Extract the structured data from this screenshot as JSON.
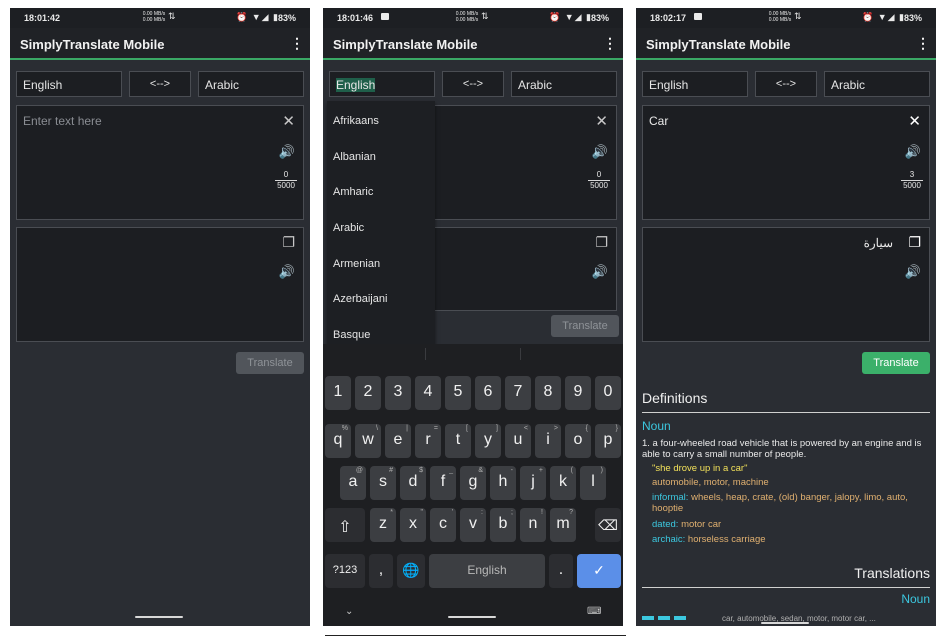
{
  "app": {
    "title": "SimplyTranslate Mobile",
    "menu_glyph": "⋮"
  },
  "screens": [
    {
      "status": {
        "time": "18:01:42",
        "net_top": "0.00 MB/s",
        "net_bottom": "0.00 MB/s",
        "battery": "83%"
      },
      "source_lang": "English",
      "swap_label": "<-->",
      "target_lang": "Arabic",
      "input_placeholder": "Enter text here",
      "counter": {
        "current": "0",
        "max": "5000"
      },
      "translate_label": "Translate"
    },
    {
      "status": {
        "time": "18:01:46",
        "net_top": "0.00 MB/s",
        "net_bottom": "0.00 MB/s",
        "battery": "83%"
      },
      "source_lang": "English",
      "swap_label": "<-->",
      "target_lang": "Arabic",
      "counter": {
        "current": "0",
        "max": "5000"
      },
      "translate_label": "Translate",
      "dropdown": [
        "Afrikaans",
        "Albanian",
        "Amharic",
        "Arabic",
        "Armenian",
        "Azerbaijani",
        "Basque"
      ],
      "keyboard": {
        "row_numbers": [
          "1",
          "2",
          "3",
          "4",
          "5",
          "6",
          "7",
          "8",
          "9",
          "0"
        ],
        "row1": [
          {
            "k": "q",
            "s": "%"
          },
          {
            "k": "w",
            "s": "\\"
          },
          {
            "k": "e",
            "s": "|"
          },
          {
            "k": "r",
            "s": "="
          },
          {
            "k": "t",
            "s": "["
          },
          {
            "k": "y",
            "s": "]"
          },
          {
            "k": "u",
            "s": "<"
          },
          {
            "k": "i",
            "s": ">"
          },
          {
            "k": "o",
            "s": "{"
          },
          {
            "k": "p",
            "s": "}"
          }
        ],
        "row2": [
          {
            "k": "a",
            "s": "@"
          },
          {
            "k": "s",
            "s": "#"
          },
          {
            "k": "d",
            "s": "$"
          },
          {
            "k": "f",
            "s": "_"
          },
          {
            "k": "g",
            "s": "&"
          },
          {
            "k": "h",
            "s": "-"
          },
          {
            "k": "j",
            "s": "+"
          },
          {
            "k": "k",
            "s": "("
          },
          {
            "k": "l",
            "s": ")"
          }
        ],
        "row3": [
          {
            "k": "z",
            "s": "*"
          },
          {
            "k": "x",
            "s": "\""
          },
          {
            "k": "c",
            "s": "'"
          },
          {
            "k": "v",
            "s": ":"
          },
          {
            "k": "b",
            "s": ";"
          },
          {
            "k": "n",
            "s": "!"
          },
          {
            "k": "m",
            "s": "?"
          }
        ],
        "symbols_label": "?123",
        "comma": ",",
        "space_label": "English",
        "period": "."
      }
    },
    {
      "status": {
        "time": "18:02:17",
        "net_top": "0.00 MB/s",
        "net_bottom": "0.00 MB/s",
        "battery": "83%"
      },
      "source_lang": "English",
      "swap_label": "<-->",
      "target_lang": "Arabic",
      "input_text": "Car",
      "counter": {
        "current": "3",
        "max": "5000"
      },
      "output_text": "سيارة",
      "translate_label": "Translate",
      "definitions": {
        "heading": "Definitions",
        "pos": "Noun",
        "definition": "1. a four-wheeled road vehicle that is powered by an engine and is able to carry a small number of people.",
        "example": "\"she drove up in a car\"",
        "synonyms": "automobile, motor, machine",
        "informal_label": "informal:",
        "informal": "wheels, heap, crate, (old) banger, jalopy, limo, auto, hooptie",
        "dated_label": "dated:",
        "dated": "motor car",
        "archaic_label": "archaic:",
        "archaic": "horseless carriage"
      },
      "translations": {
        "heading": "Translations",
        "pos": "Noun",
        "row_text": "car, automobile, sedan, motor, motor car, ..."
      }
    }
  ],
  "colors": {
    "accent": "#3aa865",
    "link": "#3cc8e0",
    "keyboard_enter": "#5b8fe8"
  }
}
